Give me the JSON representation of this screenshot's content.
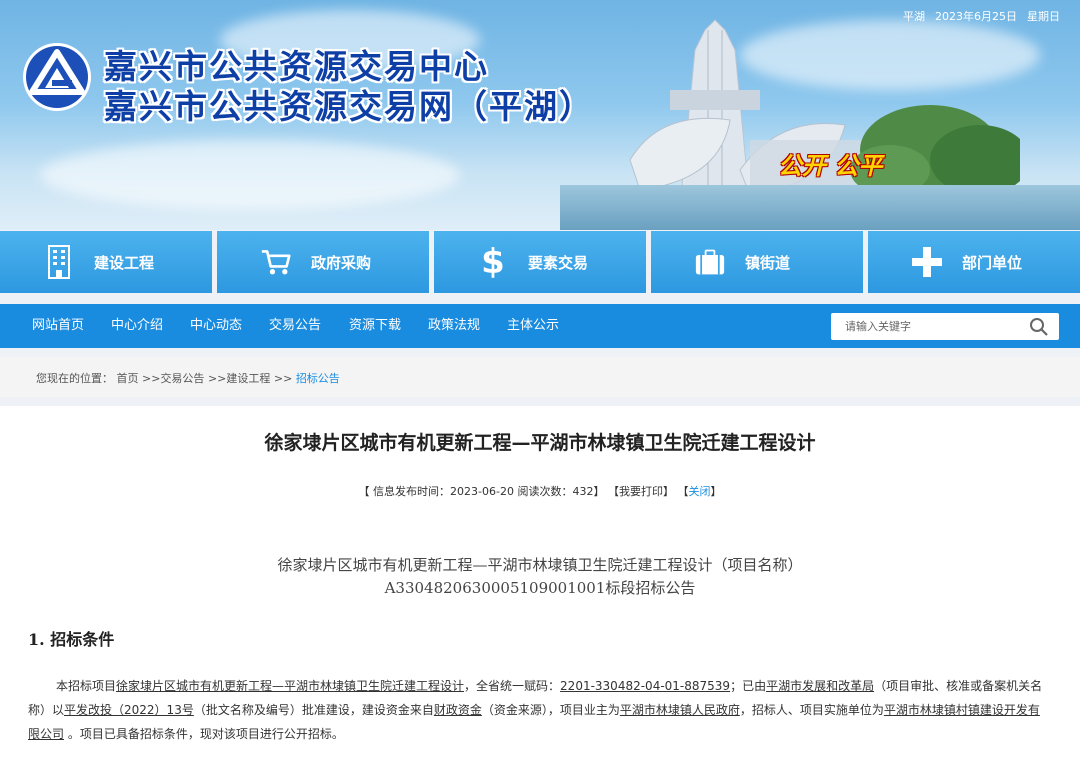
{
  "header": {
    "region": "平湖",
    "date": "2023年6月25日",
    "weekday": "星期日",
    "title_line1": "嘉兴市公共资源交易中心",
    "title_line2": "嘉兴市公共资源交易网（平湖）",
    "slogan": "公开 公平",
    "logo_icon": "g-logo-icon",
    "colors": {
      "title": "#0d3fa6",
      "slogan": "#ffd400"
    }
  },
  "categories": [
    {
      "label": "建设工程",
      "icon": "building-icon"
    },
    {
      "label": "政府采购",
      "icon": "cart-icon"
    },
    {
      "label": "要素交易",
      "icon": "dollar-icon"
    },
    {
      "label": "镇街道",
      "icon": "briefcase-icon"
    },
    {
      "label": "部门单位",
      "icon": "plus-icon"
    }
  ],
  "nav": {
    "items": [
      "网站首页",
      "中心介绍",
      "中心动态",
      "交易公告",
      "资源下载",
      "政策法规",
      "主体公示"
    ],
    "search_placeholder": "请输入关键字",
    "search_icon": "search-icon",
    "color": "#1a8ce0"
  },
  "breadcrumb": {
    "prefix": "您现在的位置：",
    "home": "首页",
    "sep": " >>",
    "level1": "交易公告",
    "level2": "建设工程",
    "current": "招标公告"
  },
  "article": {
    "title": "徐家埭片区城市有机更新工程—平湖市林埭镇卫生院迁建工程设计",
    "meta_open": "【 信息发布时间：",
    "publish_time": "2023-06-20",
    "views_label": "阅读次数：",
    "views": "432",
    "meta_close": "】",
    "print_label": "【我要打印】",
    "close_open": "【",
    "close_label": "关闭",
    "close_close": "】",
    "doc_title_line1": "徐家埭片区城市有机更新工程—平湖市林埭镇卫生院迁建工程设计（项目名称）",
    "doc_title_line2": "A3304820630005109001001标段招标公告",
    "section1": "1.  招标条件",
    "para": {
      "t1": "本招标项目",
      "u1": "徐家埭片区城市有机更新工程—平湖市林埭镇卫生院迁建工程设计",
      "t2": "，全省统一赋码：",
      "u2": "2201-330482-04-01-887539",
      "t3": "；已由",
      "u3": "平湖市发展和改革局",
      "t4": "（项目审批、核准或备案机关名称）以",
      "u4": "平发改投（2022）13号",
      "t5": "（批文名称及编号）批准建设，建设资金来自",
      "u5": "财政资金",
      "t6": "（资金来源），项目业主为",
      "u6": "平湖市林埭镇人民政府",
      "t7": "，招标人、项目实施单位为",
      "u7": "平湖市林埭镇村镇建设开发有限公司",
      "t8": " 。项目已具备招标条件，现对该项目进行公开招标。"
    }
  }
}
